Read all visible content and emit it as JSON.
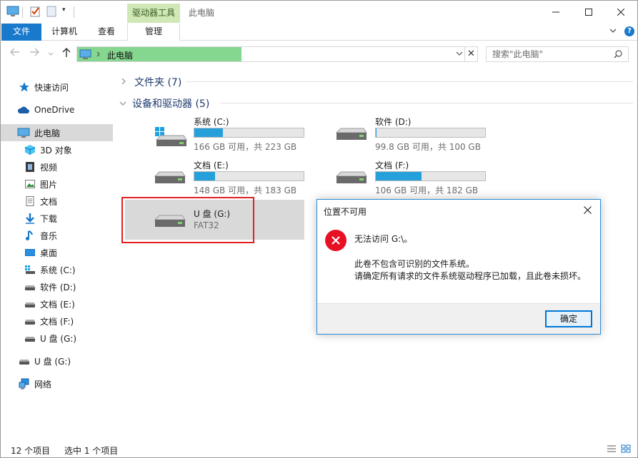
{
  "titlebar": {
    "context_tab": "驱动器工具",
    "title": "此电脑"
  },
  "ribbon": {
    "tabs": [
      "文件",
      "计算机",
      "查看",
      "管理"
    ],
    "help": "?"
  },
  "address": {
    "path": "此电脑",
    "search_placeholder": "搜索\"此电脑\""
  },
  "sidebar": {
    "items": [
      {
        "label": "快速访问",
        "icon": "star-icon"
      },
      {
        "label": "OneDrive",
        "icon": "cloud-icon"
      },
      {
        "label": "此电脑",
        "icon": "computer-icon"
      },
      {
        "label": "3D 对象",
        "icon": "cube-icon"
      },
      {
        "label": "视频",
        "icon": "video-icon"
      },
      {
        "label": "图片",
        "icon": "picture-icon"
      },
      {
        "label": "文档",
        "icon": "document-icon"
      },
      {
        "label": "下载",
        "icon": "download-icon"
      },
      {
        "label": "音乐",
        "icon": "music-icon"
      },
      {
        "label": "桌面",
        "icon": "desktop-icon"
      },
      {
        "label": "系统 (C:)",
        "icon": "drive-icon"
      },
      {
        "label": "软件 (D:)",
        "icon": "drive-icon"
      },
      {
        "label": "文档 (E:)",
        "icon": "drive-icon"
      },
      {
        "label": "文档 (F:)",
        "icon": "drive-icon"
      },
      {
        "label": "U 盘 (G:)",
        "icon": "usb-drive-icon"
      },
      {
        "label": "U 盘 (G:)",
        "icon": "usb-drive-icon"
      },
      {
        "label": "网络",
        "icon": "network-icon"
      }
    ]
  },
  "content": {
    "folders_header": "文件夹 (7)",
    "devices_header": "设备和驱动器 (5)",
    "drives": [
      {
        "name": "系统 (C:)",
        "info": "166 GB 可用，共 223 GB",
        "used_fraction": 0.26
      },
      {
        "name": "软件 (D:)",
        "info": "99.8 GB 可用，共 100 GB",
        "used_fraction": 0.002
      },
      {
        "name": "文档 (E:)",
        "info": "148 GB 可用，共 183 GB",
        "used_fraction": 0.19
      },
      {
        "name": "文档 (F:)",
        "info": "106 GB 可用，共 182 GB",
        "used_fraction": 0.42
      },
      {
        "name": "U 盘 (G:)",
        "fs": "FAT32"
      }
    ]
  },
  "status": {
    "count": "12 个项目",
    "selected": "选中 1 个项目"
  },
  "dialog": {
    "title": "位置不可用",
    "main": "无法访问 G:\\。",
    "detail1": "此卷不包含可识别的文件系统。",
    "detail2": "请确定所有请求的文件系统驱动程序已加载，且此卷未损坏。",
    "ok": "确定"
  },
  "colors": {
    "accent": "#1979ca",
    "drive_tools": "#cfe8b5",
    "bar_fill": "#26a0da",
    "error": "#e81123",
    "highlight": "#e02020"
  }
}
